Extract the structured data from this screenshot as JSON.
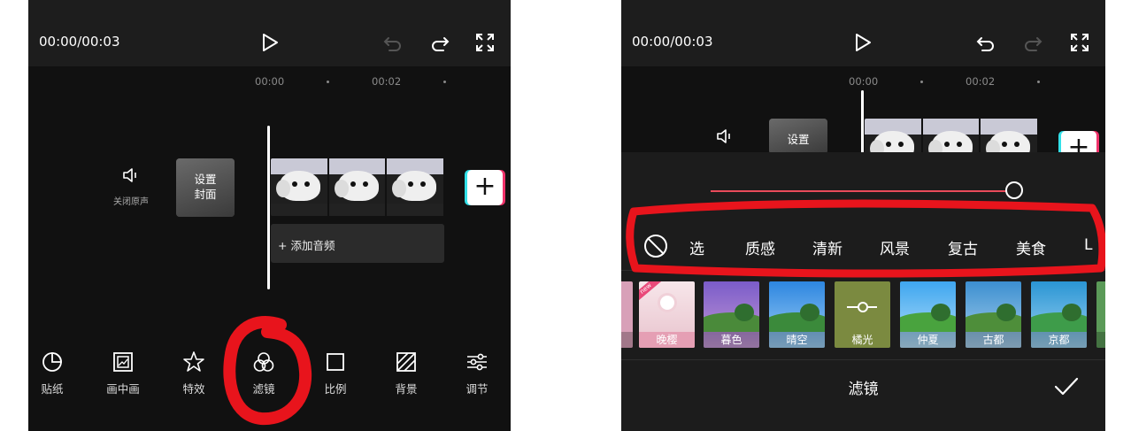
{
  "left": {
    "time": "00:00/00:03",
    "ruler": [
      "00:00",
      "00:02"
    ],
    "mute_label": "关闭原声",
    "cover_line1": "设置",
    "cover_line2": "封面",
    "add_audio": "+ 添加音频",
    "toolbar": [
      {
        "label": "贴纸",
        "icon": "sticker-icon"
      },
      {
        "label": "画中画",
        "icon": "picture-in-picture-icon"
      },
      {
        "label": "特效",
        "icon": "effects-star-icon"
      },
      {
        "label": "滤镜",
        "icon": "filter-icon"
      },
      {
        "label": "比例",
        "icon": "ratio-icon"
      },
      {
        "label": "背景",
        "icon": "background-icon"
      },
      {
        "label": "调节",
        "icon": "adjust-icon"
      }
    ]
  },
  "right": {
    "time": "00:00/00:03",
    "ruler": [
      "00:00",
      "00:02"
    ],
    "cover_line1": "设置",
    "filter_intensity": 1.0,
    "categories": [
      "选",
      "质感",
      "清新",
      "风景",
      "复古",
      "美食",
      "L"
    ],
    "filters": [
      {
        "label": "",
        "color": "#d8a0b8"
      },
      {
        "label": "晚樱",
        "color": "#f2d6dd",
        "new": true
      },
      {
        "label": "暮色",
        "color": "#9d7bd1"
      },
      {
        "label": "晴空",
        "color": "#3f9be8"
      },
      {
        "label": "橘光",
        "color": "#7b8a40",
        "selected": true
      },
      {
        "label": "仲夏",
        "color": "#4fb3f2"
      },
      {
        "label": "古都",
        "color": "#4b9fd8"
      },
      {
        "label": "京都",
        "color": "#3fa1da"
      },
      {
        "label": "",
        "color": "#5b9a58"
      }
    ],
    "new_badge": "new",
    "bottom_title": "滤镜"
  },
  "colors": {
    "accent_red": "#e94a5a",
    "annotation_red": "#e8141c"
  }
}
